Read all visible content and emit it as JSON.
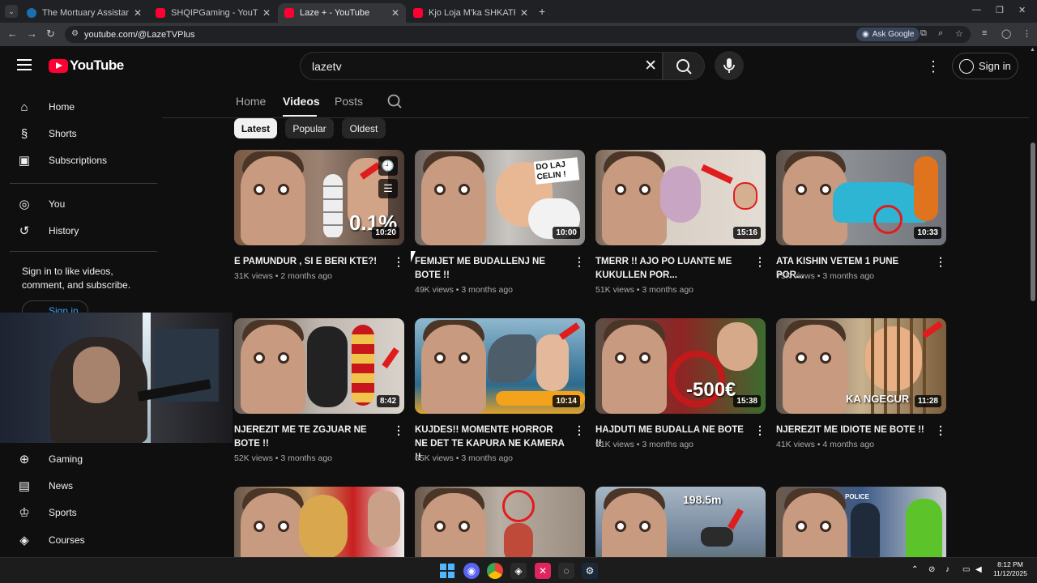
{
  "browser": {
    "tabs": [
      {
        "title": "The Mortuary Assistant on Stea",
        "icon": "steam-icon",
        "active": false
      },
      {
        "title": "SHQIPGaming - YouTube",
        "icon": "youtube-icon",
        "active": false
      },
      {
        "title": "Laze + - YouTube",
        "icon": "youtube-icon",
        "active": true
      },
      {
        "title": "Kjo Loja M'ka SHKATRRU | Iblis",
        "icon": "youtube-icon",
        "active": false
      }
    ],
    "new_tab_label": "+",
    "url": "youtube.com/@LazeTVPlus",
    "ask_google": "Ask Google"
  },
  "youtube": {
    "logo_text": "YouTube",
    "search_value": "lazetv",
    "sign_in": "Sign in"
  },
  "sidebar": {
    "top": [
      {
        "label": "Home",
        "icon": "home-icon"
      },
      {
        "label": "Shorts",
        "icon": "shorts-icon"
      },
      {
        "label": "Subscriptions",
        "icon": "subscriptions-icon"
      }
    ],
    "you": [
      {
        "label": "You",
        "icon": "you-icon"
      },
      {
        "label": "History",
        "icon": "history-icon"
      }
    ],
    "sign_in_message": "Sign in to like videos, comment, and subscribe.",
    "sign_in_button": "Sign in",
    "explore": [
      {
        "label": "Gaming",
        "icon": "gaming-icon"
      },
      {
        "label": "News",
        "icon": "news-icon"
      },
      {
        "label": "Sports",
        "icon": "sports-icon"
      },
      {
        "label": "Courses",
        "icon": "courses-icon"
      }
    ]
  },
  "channel": {
    "tabs": [
      "Home",
      "Videos",
      "Posts"
    ],
    "active_tab": "Videos",
    "chips": [
      "Latest",
      "Popular",
      "Oldest"
    ],
    "active_chip": "Latest"
  },
  "videos": [
    {
      "title": "E PAMUNDUR , SI E BERI KTE?!",
      "views": "31K views",
      "age": "2 months ago",
      "duration": "10:20",
      "overlay_text": "0.1%"
    },
    {
      "title": "FEMIJET ME BUDALLENJ NE BOTE !!",
      "views": "49K views",
      "age": "3 months ago",
      "duration": "10:00",
      "overlay_text": "DO LAJ CELIN !"
    },
    {
      "title": "TMERR !! AJO PO LUANTE ME KUKULLEN POR...",
      "views": "51K views",
      "age": "3 months ago",
      "duration": "15:16",
      "overlay_text": ""
    },
    {
      "title": "ATA KISHIN VETEM 1 PUNE POR...",
      "views": "75K views",
      "age": "3 months ago",
      "duration": "10:33",
      "overlay_text": ""
    },
    {
      "title": "NJEREZIT ME TE ZGJUAR NE BOTE !!",
      "views": "52K views",
      "age": "3 months ago",
      "duration": "8:42",
      "overlay_text": ""
    },
    {
      "title": "KUJDES!! MOMENTE HORROR NE DET TE KAPURA NE KAMERA !!",
      "views": "65K views",
      "age": "3 months ago",
      "duration": "10:14",
      "overlay_text": ""
    },
    {
      "title": "HAJDUTI ME BUDALLA NE BOTE !!",
      "views": "91K views",
      "age": "3 months ago",
      "duration": "15:38",
      "overlay_text": "-500€"
    },
    {
      "title": "NJEREZIT ME IDIOTE NE BOTE !!",
      "views": "41K views",
      "age": "4 months ago",
      "duration": "11:28",
      "overlay_text": "KA NGECUR"
    },
    {
      "title": "",
      "views": "",
      "age": "",
      "duration": "",
      "overlay_text": ""
    },
    {
      "title": "",
      "views": "",
      "age": "",
      "duration": "",
      "overlay_text": ""
    },
    {
      "title": "",
      "views": "",
      "age": "",
      "duration": "",
      "overlay_text": "198.5m"
    },
    {
      "title": "",
      "views": "",
      "age": "",
      "duration": "",
      "overlay_text": "POLICE"
    }
  ],
  "taskbar": {
    "time": "8:12 PM",
    "date": "11/12/2025"
  },
  "colors": {
    "background": "#0f0f0f",
    "brand_red": "#ff0033",
    "link_blue": "#3ea6ff"
  }
}
